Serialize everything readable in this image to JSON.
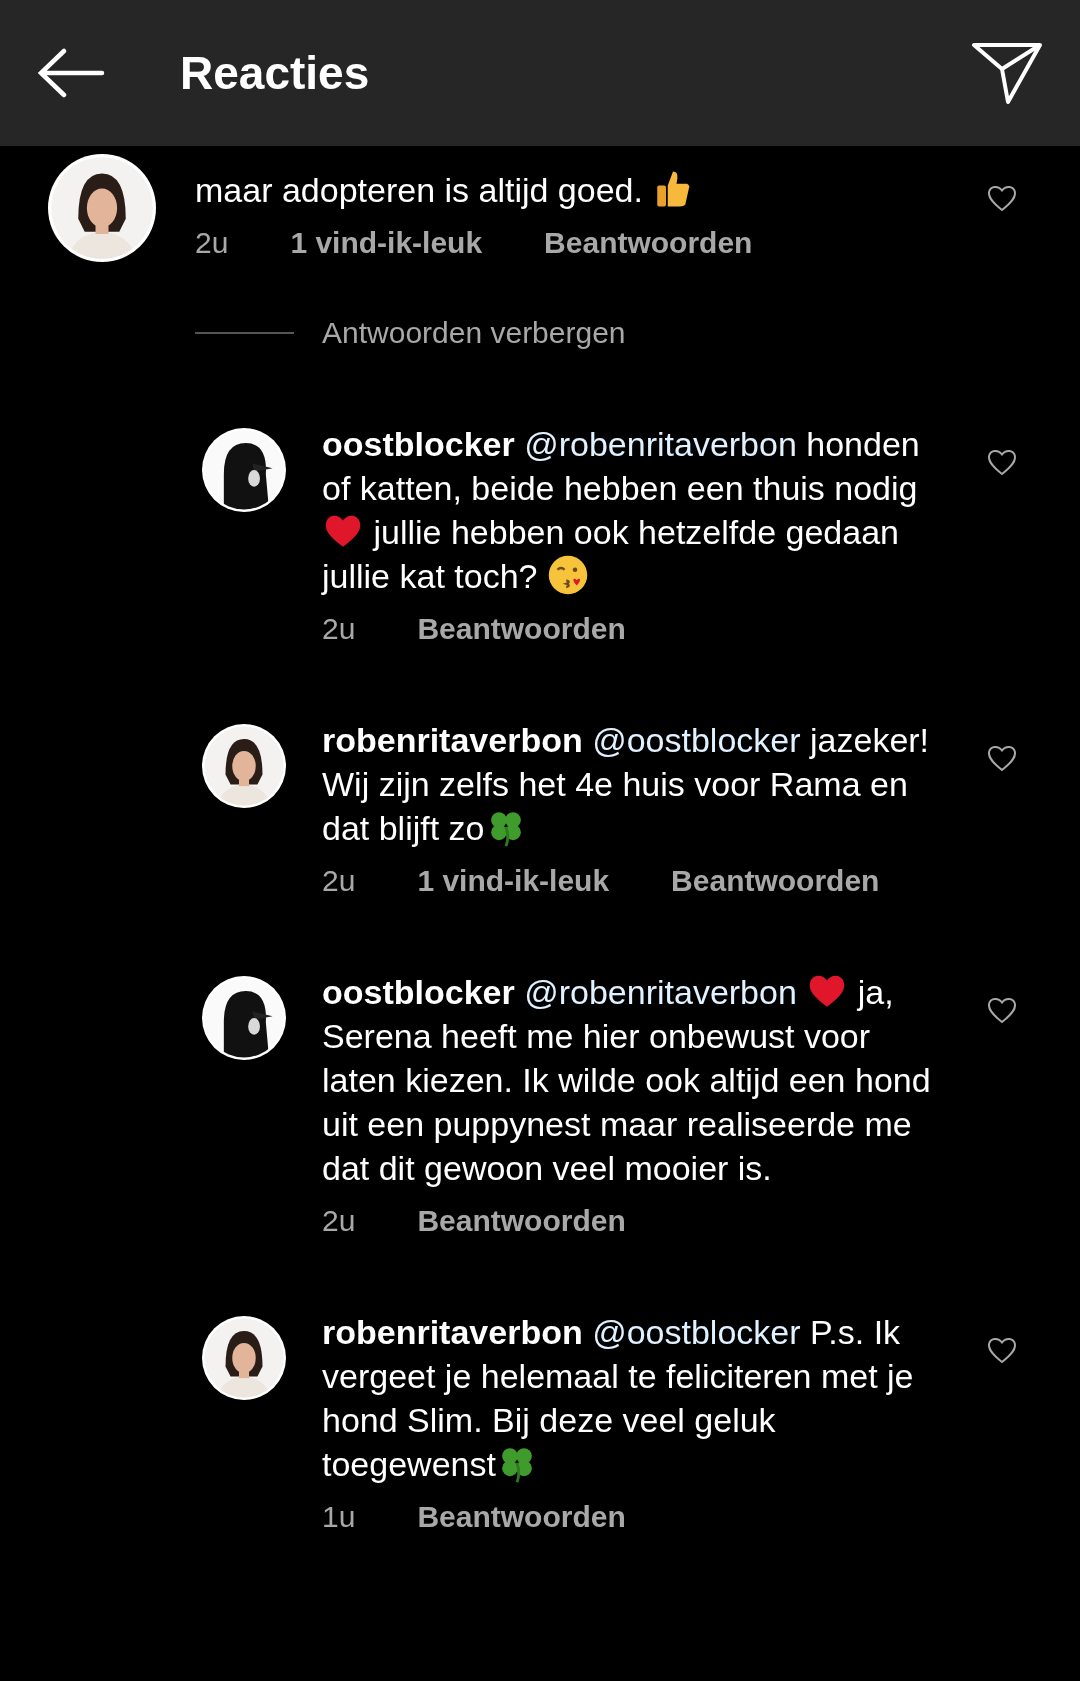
{
  "header": {
    "title": "Reacties"
  },
  "comment": {
    "body": [
      {
        "kind": "text",
        "text": "maar adopteren is altijd goed. "
      },
      {
        "kind": "thumbs-up"
      }
    ],
    "time": "2u",
    "likes": "1 vind-ik-leuk",
    "reply": "Beantwoorden"
  },
  "hide_replies": "Antwoorden verbergen",
  "replies": [
    {
      "username": "oostblocker",
      "mention": "@robenritaverbon",
      "body": [
        {
          "kind": "text",
          "text": "honden of katten, beide hebben een thuis nodig"
        },
        {
          "kind": "heart"
        },
        {
          "kind": "text",
          "text": " jullie hebben ook hetzelfde gedaan jullie kat toch? "
        },
        {
          "kind": "kiss"
        }
      ],
      "time": "2u",
      "reply": "Beantwoorden"
    },
    {
      "username": "robenritaverbon",
      "mention": "@oostblocker",
      "body": [
        {
          "kind": "text",
          "text": "jazeker! Wij zijn zelfs het 4e huis voor Rama en dat blijft zo"
        },
        {
          "kind": "clover"
        }
      ],
      "time": "2u",
      "likes": "1 vind-ik-leuk",
      "reply": "Beantwoorden"
    },
    {
      "username": "oostblocker",
      "mention": "@robenritaverbon",
      "body": [
        {
          "kind": "heart"
        },
        {
          "kind": "text",
          "text": " ja, Serena heeft me hier onbewust voor laten kiezen. Ik wilde ook altijd een hond uit een puppynest maar realiseerde me dat dit gewoon veel mooier is."
        }
      ],
      "time": "2u",
      "reply": "Beantwoorden"
    },
    {
      "username": "robenritaverbon",
      "mention": "@oostblocker",
      "body": [
        {
          "kind": "text",
          "text": "P.s. Ik vergeet je helemaal te feliciteren met je hond Slim. Bij deze veel geluk toegewenst"
        },
        {
          "kind": "clover"
        }
      ],
      "time": "1u",
      "reply": "Beantwoorden"
    }
  ]
}
